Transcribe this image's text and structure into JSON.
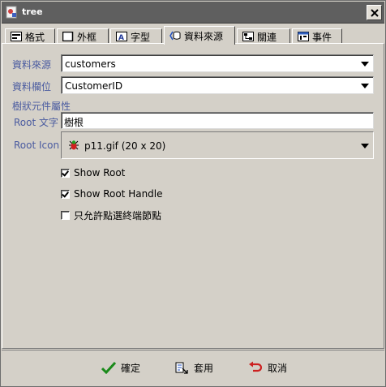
{
  "window": {
    "title": "tree"
  },
  "tabs": [
    {
      "label": "格式",
      "icon": "format-icon",
      "active": false
    },
    {
      "label": "外框",
      "icon": "border-icon",
      "active": false
    },
    {
      "label": "字型",
      "icon": "font-icon",
      "active": false
    },
    {
      "label": "資料來源",
      "icon": "datasource-icon",
      "active": true
    },
    {
      "label": "關連",
      "icon": "relation-icon",
      "active": false
    },
    {
      "label": "事件",
      "icon": "event-icon",
      "active": false
    }
  ],
  "form": {
    "datasource_label": "資料來源",
    "datasource_value": "customers",
    "field_label": "資料欄位",
    "field_value": "CustomerID",
    "section_title": "樹狀元件屬性",
    "root_text_label": "Root 文字",
    "root_text_value": "樹根",
    "root_icon_label": "Root Icon",
    "root_icon_value": "p11.gif  (20 x 20)",
    "show_root_label": "Show Root",
    "show_root_checked": true,
    "show_root_handle_label": "Show Root Handle",
    "show_root_handle_checked": true,
    "leaf_only_label": "只允許點選終端節點",
    "leaf_only_checked": false
  },
  "buttons": {
    "ok_label": "確定",
    "apply_label": "套用",
    "cancel_label": "取消"
  },
  "colors": {
    "label_blue": "#4a5ba0",
    "titlebar": "#5f5f5f",
    "ok_green": "#1a8a1a",
    "cancel_red": "#cc2020"
  }
}
